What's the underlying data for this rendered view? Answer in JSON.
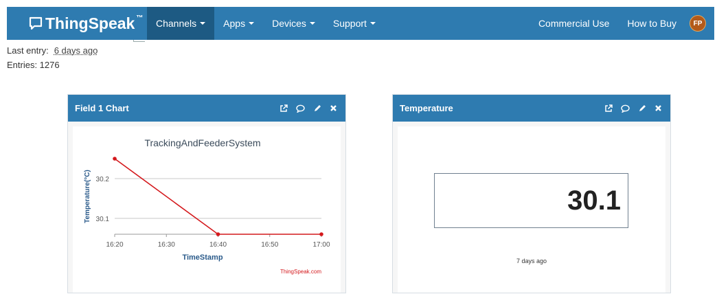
{
  "navbar": {
    "brand": "ThingSpeak",
    "brand_tm": "™",
    "items": [
      {
        "label": "Channels"
      },
      {
        "label": "Apps"
      },
      {
        "label": "Devices"
      },
      {
        "label": "Support"
      }
    ],
    "right": {
      "commercial": "Commercial Use",
      "how_to_buy": "How to Buy",
      "avatar_initials": "FP"
    },
    "colors": {
      "bar": "#2e7bb0",
      "active": "#1d5a83",
      "avatar": "#b25a1a"
    }
  },
  "channel_info": {
    "last_entry_label": "Last entry:",
    "last_entry_value": "6 days ago",
    "entries_label": "Entries: 1276"
  },
  "field_chart_panel": {
    "title": "Field 1 Chart",
    "icons": [
      "external-link-icon",
      "comment-icon",
      "pencil-icon",
      "close-icon"
    ]
  },
  "temperature_panel": {
    "title": "Temperature",
    "icons": [
      "external-link-icon",
      "comment-icon",
      "pencil-icon",
      "close-icon"
    ],
    "value": "30.1",
    "updated": "7 days ago"
  },
  "chart_data": {
    "type": "line",
    "title": "TrackingAndFeederSystem",
    "xlabel": "TimeStamp",
    "ylabel": "Temperature(°C)",
    "credit": "ThingSpeak.com",
    "x_ticks": [
      "16:20",
      "16:30",
      "16:40",
      "16:50",
      "17:00"
    ],
    "y_ticks": [
      30.1,
      30.2
    ],
    "series": [
      {
        "x": [
          "16:20",
          "16:40",
          "17:00"
        ],
        "y": [
          30.25,
          30.06,
          30.06
        ],
        "color": "#d4181c"
      }
    ],
    "ylim": [
      30.06,
      30.25
    ],
    "grid": true
  }
}
